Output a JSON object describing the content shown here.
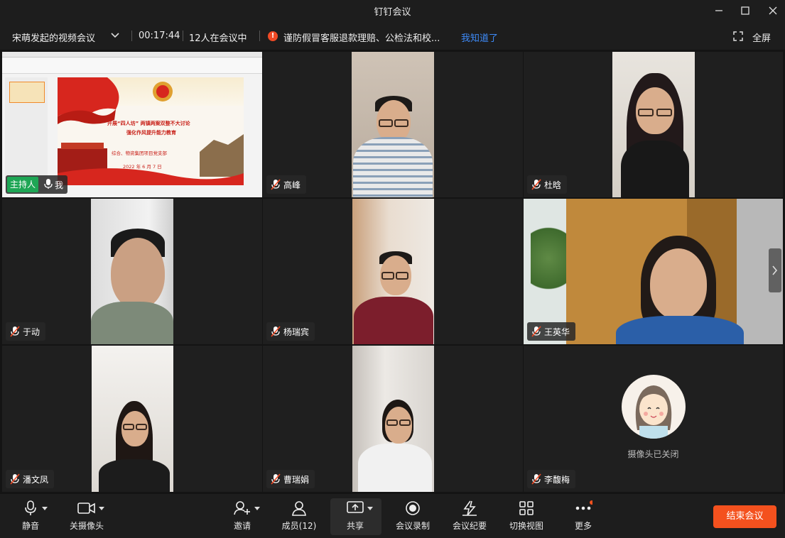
{
  "window": {
    "title": "钉钉会议"
  },
  "infobar": {
    "meeting_name": "宋萌发起的视频会议",
    "duration": "00:17:44",
    "participants_status": "12人在会议中",
    "notice": "谨防假冒客服退款理赔、公检法和校...",
    "notice_ack": "我知道了",
    "fullscreen": "全屏"
  },
  "slide": {
    "line1": "开展“四人坊” 两镇两案双整不大讨论",
    "line2": "强化作风提升能力教育",
    "line3": "综合、物资集团项目党支部",
    "date": "2022 年 6 月 7 日"
  },
  "tiles": {
    "host_badge": "主持人",
    "self_name": "我",
    "names": [
      "高峰",
      "杜晗",
      "于动",
      "杨瑞宾",
      "王英华",
      "潘文凤",
      "曹瑞娟",
      "李馥梅"
    ],
    "camera_off": "摄像头已关闭"
  },
  "toolbar": {
    "mute": "静音",
    "camera_off": "关摄像头",
    "invite": "邀请",
    "members": "成员(12)",
    "share": "共享",
    "record": "会议录制",
    "minutes": "会议纪要",
    "switch_view": "切换视图",
    "more": "更多",
    "end": "结束会议"
  },
  "colors": {
    "end_button": "#f4511e",
    "host_badge": "#1ea655",
    "link": "#3d8af7",
    "warning": "#f04a25"
  },
  "icons": [
    "minimize-icon",
    "maximize-icon",
    "close-icon",
    "chevron-down-icon",
    "warning-icon",
    "fullscreen-icon",
    "mic-icon",
    "mic-muted-icon",
    "camera-icon",
    "invite-icon",
    "members-icon",
    "share-icon",
    "record-icon",
    "minutes-icon",
    "grid-view-icon",
    "more-icon",
    "chevron-right-icon"
  ]
}
